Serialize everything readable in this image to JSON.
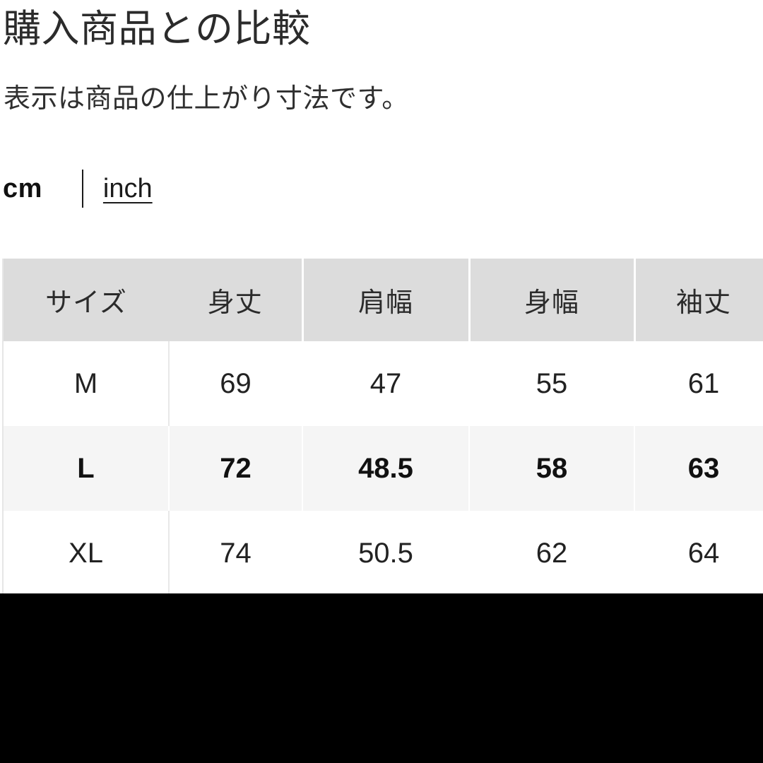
{
  "header": {
    "title": "購入商品との比較",
    "subtitle": "表示は商品の仕上がり寸法です。"
  },
  "unit_toggle": {
    "active_unit": "cm",
    "alternate_unit": "inch",
    "divider": "|"
  },
  "size_table": {
    "columns": [
      "サイズ",
      "身丈",
      "肩幅",
      "身幅",
      "袖丈"
    ],
    "rows": [
      {
        "size": "M",
        "height": "69",
        "shoulder": "47",
        "chest": "55",
        "sleeve": "61",
        "highlighted": false
      },
      {
        "size": "L",
        "height": "72",
        "shoulder": "48.5",
        "chest": "58",
        "sleeve": "63",
        "highlighted": true
      },
      {
        "size": "XL",
        "height": "74",
        "shoulder": "50.5",
        "chest": "62",
        "sleeve": "64",
        "highlighted": false
      }
    ]
  },
  "colors": {
    "header_background": "#dcdcdc",
    "highlight_row_background": "#f5f5f5",
    "text": "#222222",
    "page_background": "#ffffff",
    "band": "#000000"
  }
}
